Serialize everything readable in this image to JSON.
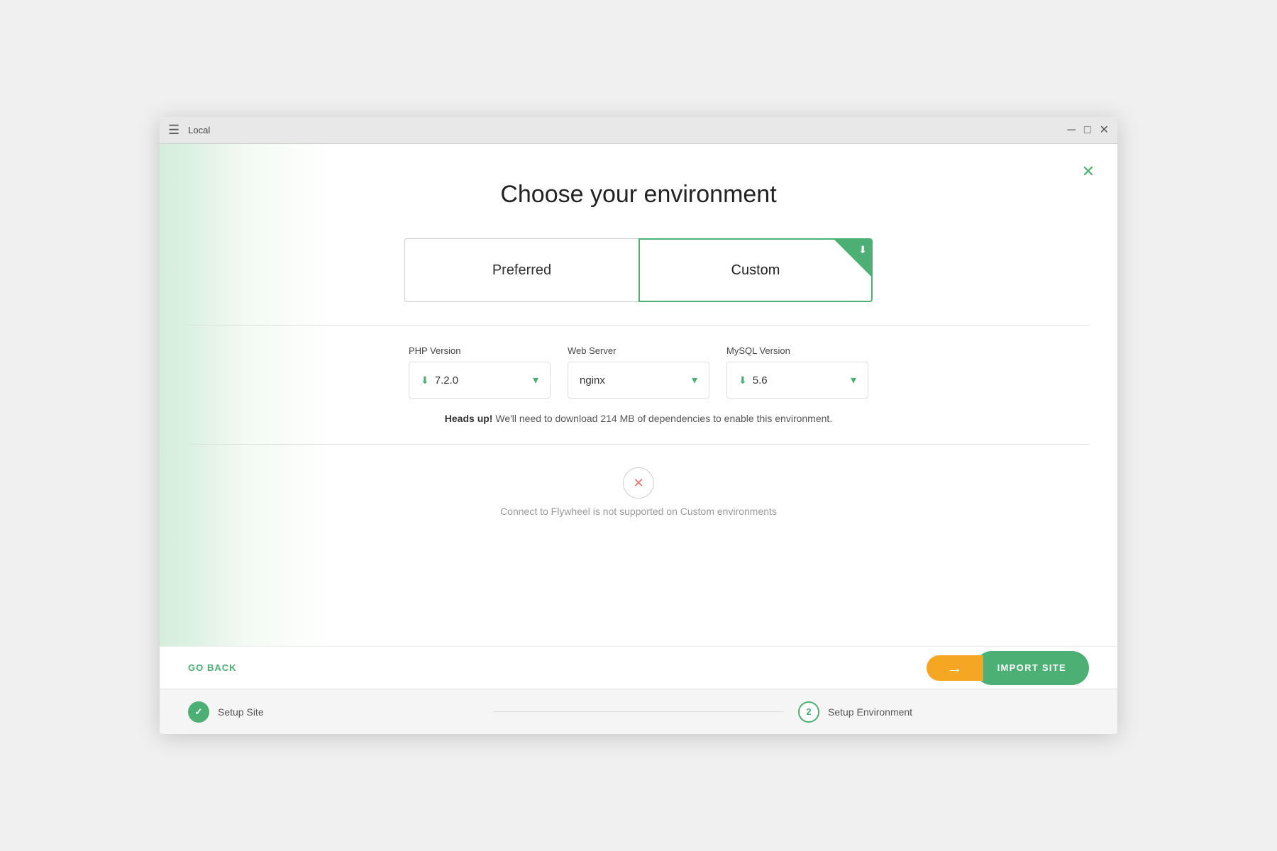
{
  "titlebar": {
    "title": "Local",
    "menu_icon": "☰",
    "minimize": "─",
    "maximize": "□",
    "close": "✕"
  },
  "close_dialog": "✕",
  "heading": "Choose your environment",
  "env_options": [
    {
      "id": "preferred",
      "label": "Preferred",
      "selected": false
    },
    {
      "id": "custom",
      "label": "Custom",
      "selected": true
    }
  ],
  "config": {
    "php": {
      "label": "PHP Version",
      "value": "7.2.0",
      "has_download": true
    },
    "webserver": {
      "label": "Web Server",
      "value": "nginx",
      "has_download": false
    },
    "mysql": {
      "label": "MySQL Version",
      "value": "5.6",
      "has_download": true
    }
  },
  "notice": {
    "bold": "Heads up!",
    "text": " We'll need to download 214 MB of dependencies to enable this environment."
  },
  "flywheel": {
    "message": "Connect to Flywheel is not supported on Custom environments"
  },
  "footer": {
    "go_back": "GO BACK",
    "import_site": "IMPORT SITE"
  },
  "steps": [
    {
      "id": 1,
      "label": "Setup Site",
      "state": "done",
      "icon": "✓"
    },
    {
      "id": 2,
      "label": "Setup Environment",
      "state": "active"
    }
  ]
}
